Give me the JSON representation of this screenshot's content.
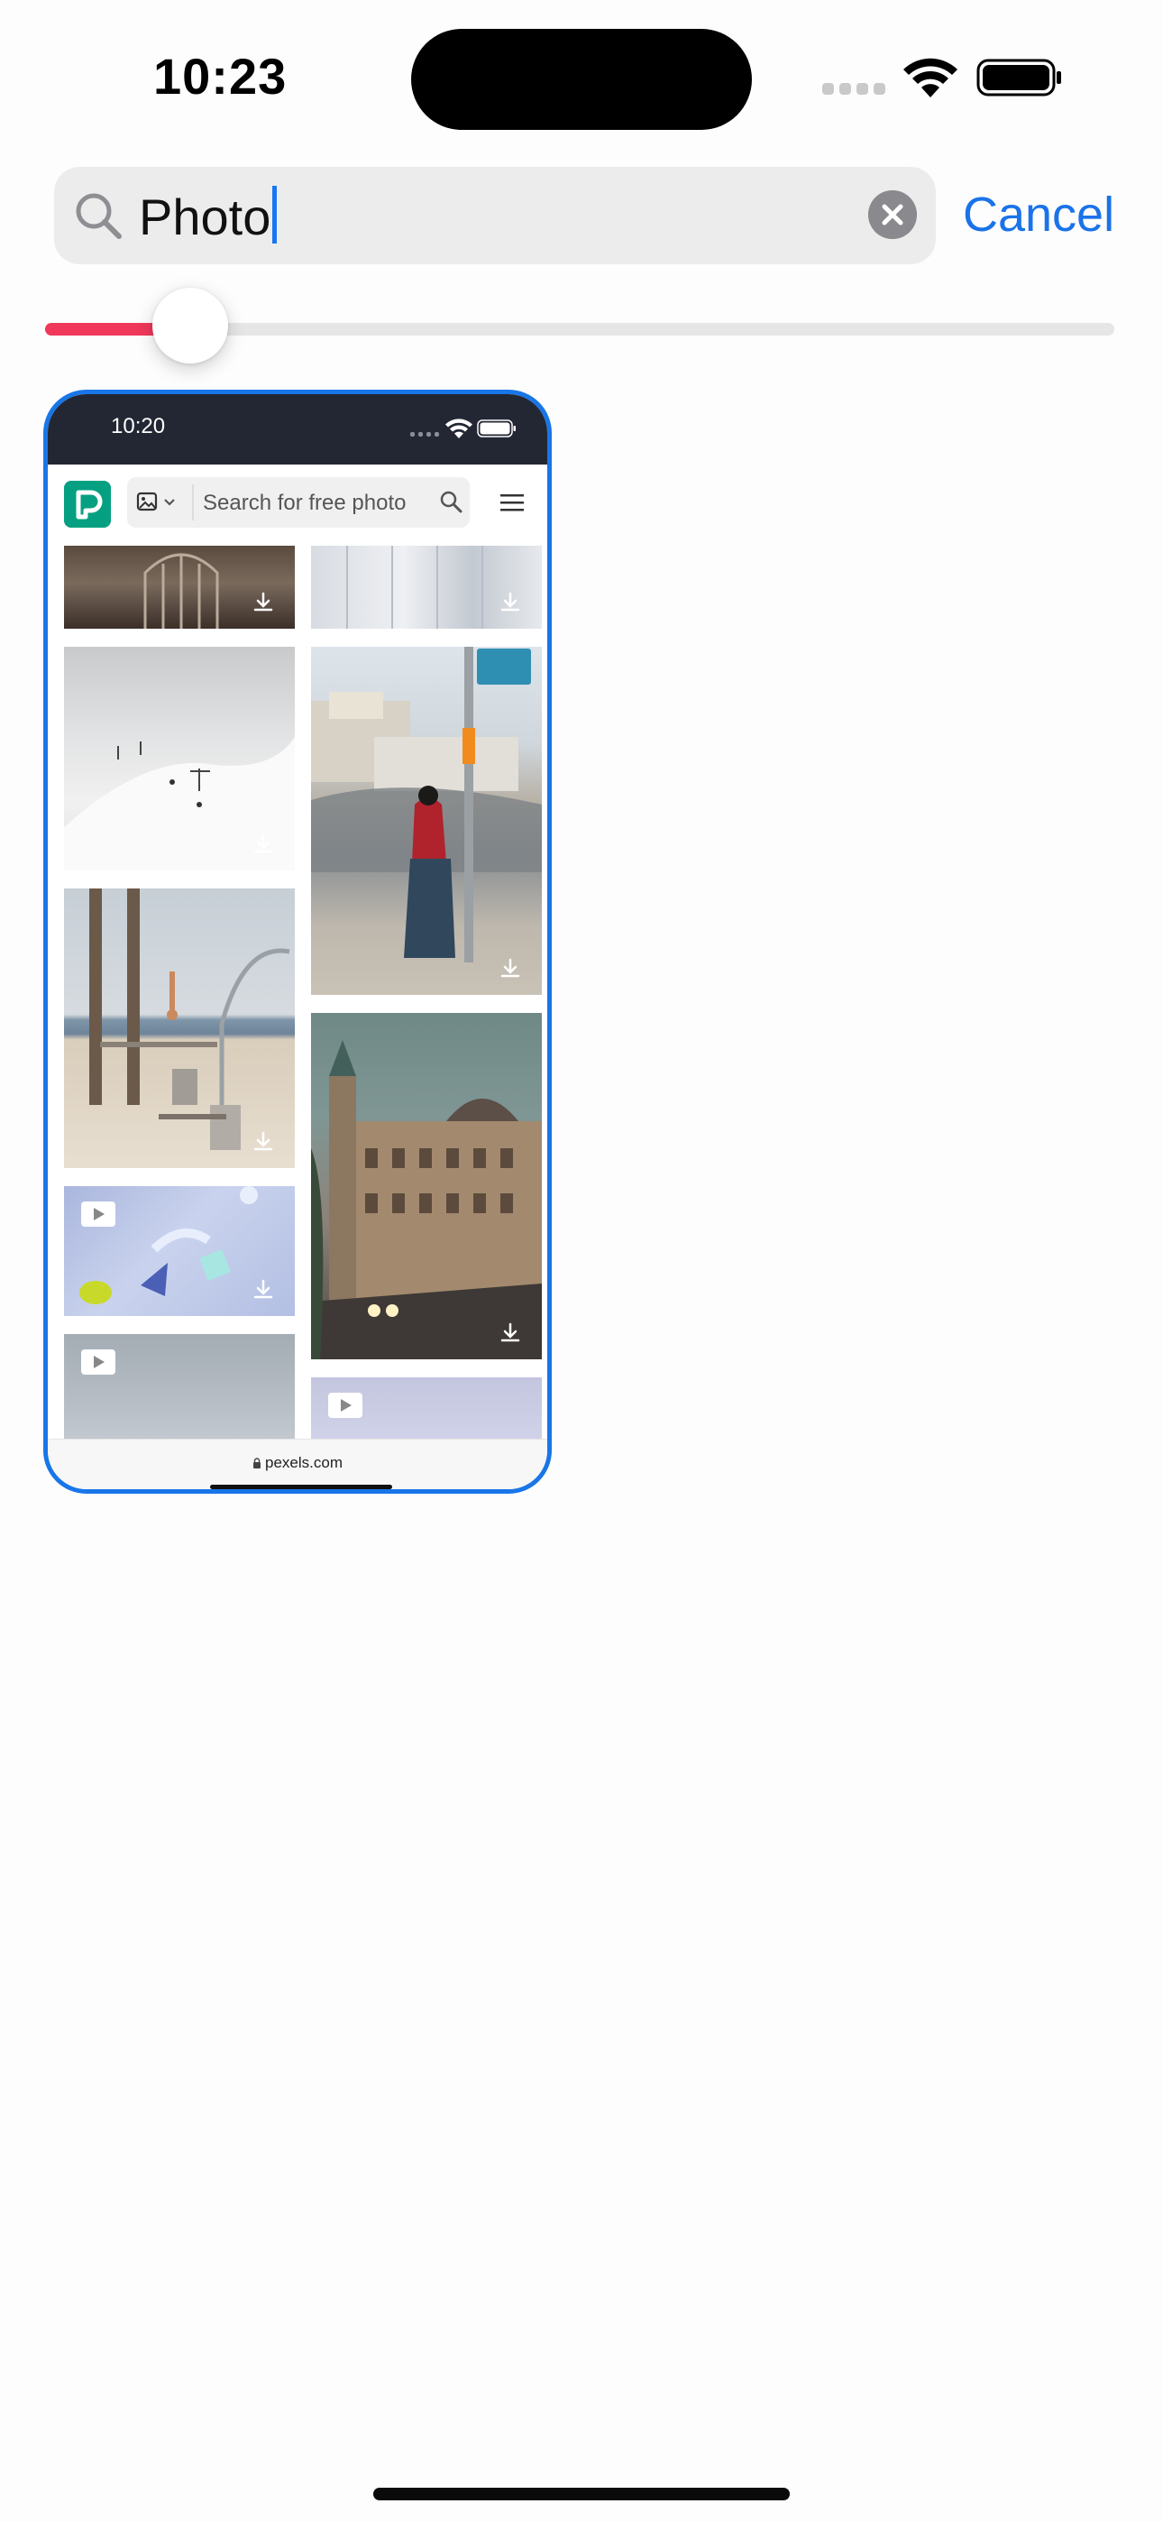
{
  "status_bar": {
    "time": "10:23"
  },
  "search": {
    "query": "Photo",
    "cancel_label": "Cancel"
  },
  "slider": {
    "value_fraction": 0.136
  },
  "tab_preview": {
    "status_time": "10:20",
    "search_placeholder": "Search for free photo",
    "url": "pexels.com",
    "accent_color": "#1976e8",
    "brand_color": "#05a081"
  }
}
